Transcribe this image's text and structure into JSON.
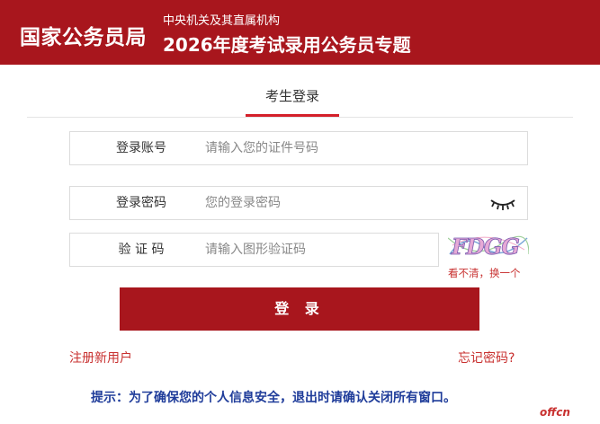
{
  "header": {
    "brand": "国家公务员局",
    "org": "中央机关及其直属机构",
    "topic": "2026年度考试录用公务员专题"
  },
  "tab": {
    "label": "考生登录"
  },
  "form": {
    "account": {
      "label": "登录账号",
      "placeholder": "请输入您的证件号码",
      "value": ""
    },
    "password": {
      "label": "登录密码",
      "placeholder": "您的登录密码",
      "value": "",
      "toggle_icon": "eye-closed-icon"
    },
    "captcha": {
      "label": "验 证 码",
      "placeholder": "请输入图形验证码",
      "value": "",
      "image_text": "FDGG",
      "refresh_link": "看不清，换一个"
    }
  },
  "actions": {
    "login": "登 录",
    "register": "注册新用户",
    "forgot": "忘记密码?"
  },
  "tip": "提示：为了确保您的个人信息安全，退出时请确认关闭所有窗口。",
  "watermark": "offcn",
  "colors": {
    "brand_red": "#a8161d",
    "accent_red": "#d4202a",
    "link_red": "#c8302f",
    "tip_blue": "#1f3c9a"
  }
}
